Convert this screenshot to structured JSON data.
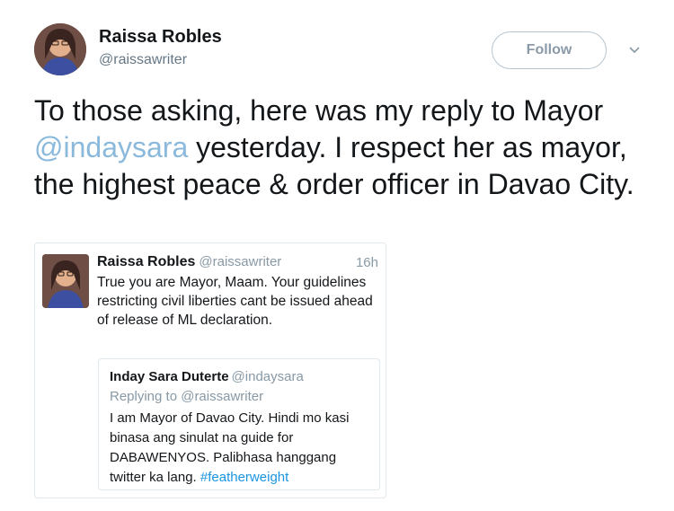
{
  "author": {
    "name": "Raissa Robles",
    "handle": "@raissawriter",
    "follow_label": "Follow"
  },
  "tweet": {
    "text_before": "To those asking, here was my reply to Mayor",
    "mention": "@indaysara",
    "text_after": "yesterday. I respect her as mayor, the highest peace & order officer in Davao City."
  },
  "quoted_tweet": {
    "name": "Raissa Robles",
    "handle": "@raissawriter",
    "time": "16h",
    "text": "True you are Mayor, Maam. Your guidelines restricting civil liberties cant be issued ahead of release of ML declaration.",
    "nested": {
      "name": "Inday Sara Duterte",
      "handle": "@indaysara",
      "replying_to": "Replying to @raissawriter",
      "text": "I am Mayor of Davao City. Hindi mo kasi binasa ang sinulat na guide for DABAWENYOS. Palibhasa hanggang twitter ka lang.",
      "hashtag": "#featherweight"
    }
  },
  "colors": {
    "mention": "#8bb9dc",
    "hashtag": "#1b95e0",
    "follow_border": "#b8c5cf"
  }
}
